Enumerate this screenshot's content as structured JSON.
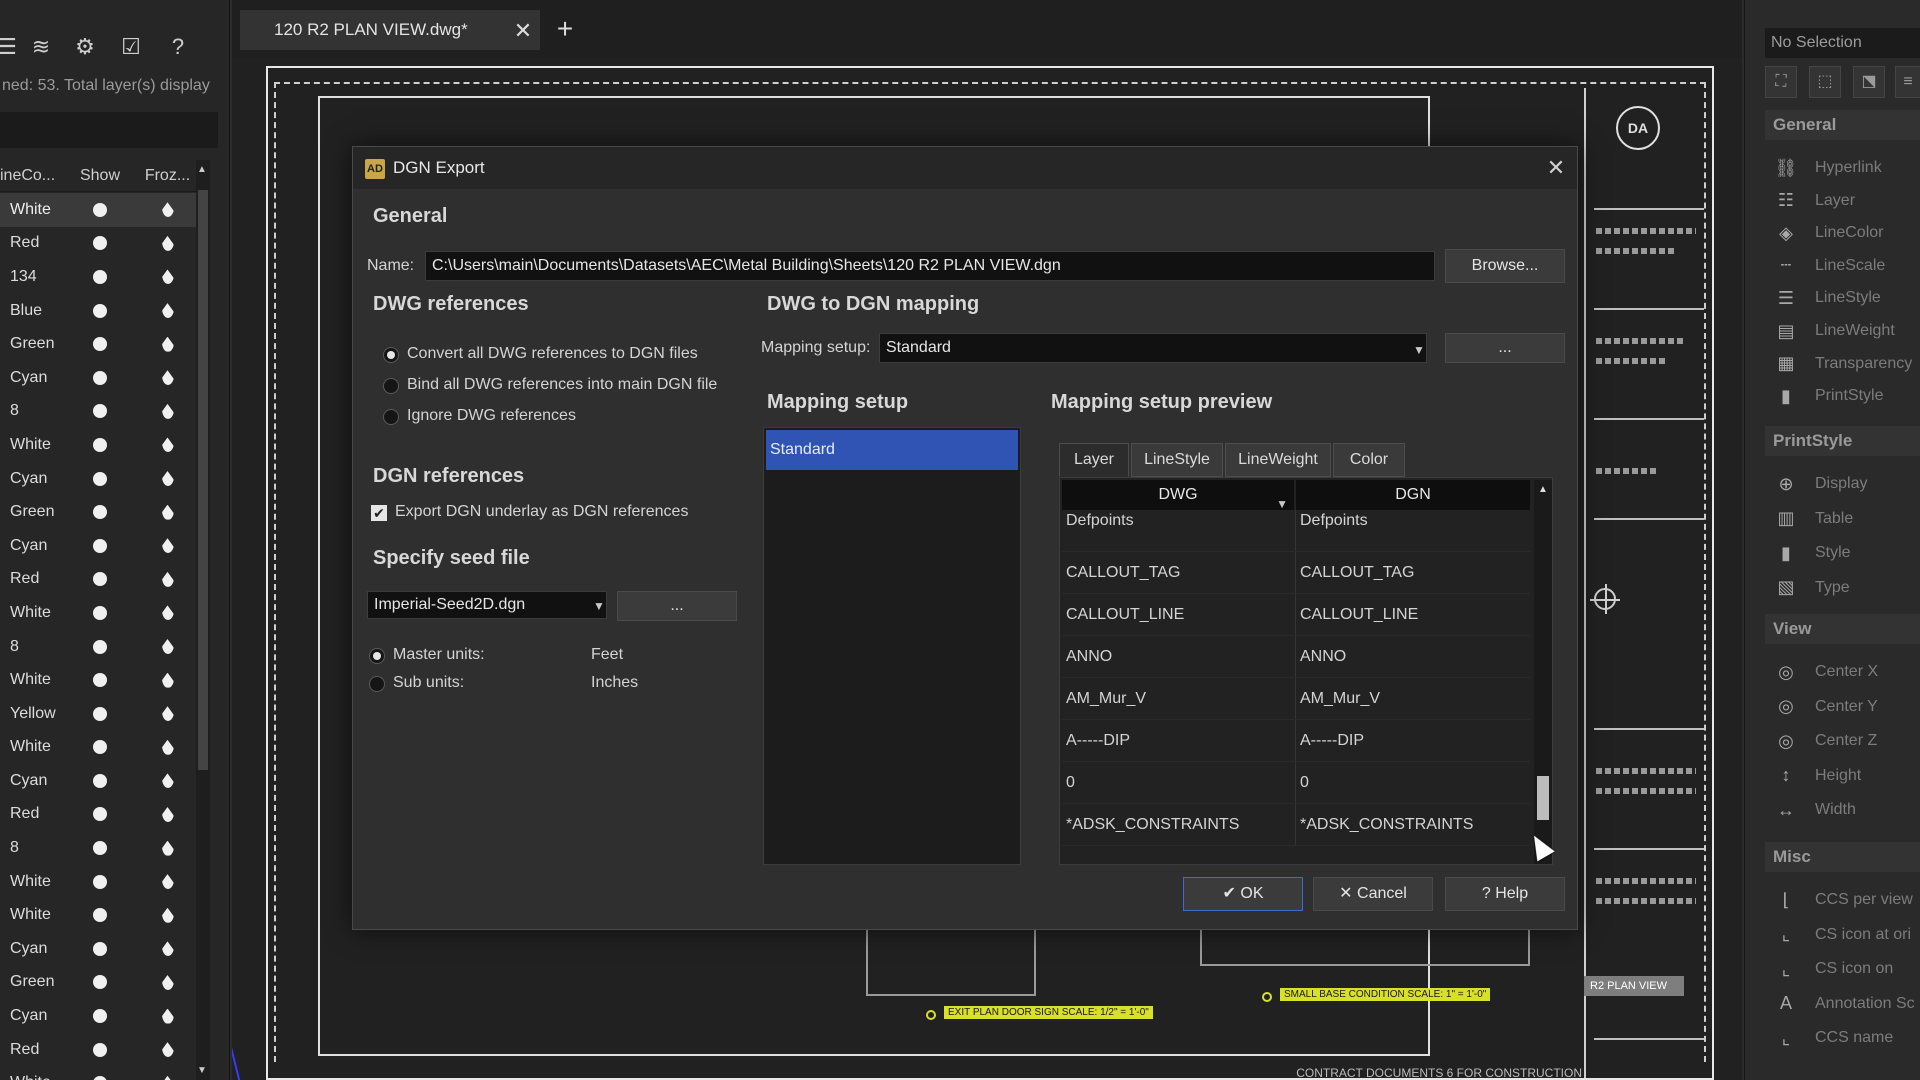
{
  "left_panel": {
    "toolbar_icons": [
      "layer-list-icon",
      "layer-filter-icon",
      "settings-gear-icon",
      "layer-check-icon",
      "help-icon"
    ],
    "summary": "ned: 53. Total layer(s) display",
    "columns": {
      "linecolor": "ineCo...",
      "show": "Show",
      "frozen": "Froz..."
    },
    "layers": [
      "White",
      "Red",
      "134",
      "Blue",
      "Green",
      "Cyan",
      "8",
      "White",
      "Cyan",
      "Green",
      "Cyan",
      "Red",
      "White",
      "8",
      "White",
      "Yellow",
      "White",
      "Cyan",
      "Red",
      "8",
      "White",
      "White",
      "Cyan",
      "Green",
      "Cyan",
      "Red",
      "White"
    ]
  },
  "tabbar": {
    "doc_tab": "120 R2 PLAN VIEW.dwg*",
    "close_glyph": "✕",
    "new_tab_glyph": "+"
  },
  "canvas": {
    "plan_label": "R2 PLAN VIEW",
    "footer": "CONTRACT DOCUMENTS 6 FOR CONSTRUCTION",
    "seal_text": "DA",
    "callout_a": "EXIT PLAN DOOR SIGN  SCALE: 1/2\" = 1'-0\"",
    "callout_b": "SMALL BASE CONDITION  SCALE: 1\" = 1'-0\""
  },
  "dialog": {
    "title": "DGN Export",
    "close_glyph": "✕",
    "general": {
      "heading": "General",
      "name_label": "Name:",
      "name_value": "C:\\Users\\main\\Documents\\Datasets\\AEC\\Metal Building\\Sheets\\120 R2 PLAN VIEW.dgn",
      "browse": "Browse..."
    },
    "dwg_references": {
      "heading": "DWG references",
      "options": [
        {
          "label": "Convert all DWG references to DGN files",
          "selected": true
        },
        {
          "label": "Bind all DWG references into main DGN file",
          "selected": false
        },
        {
          "label": "Ignore DWG references",
          "selected": false
        }
      ]
    },
    "dgn_references": {
      "heading": "DGN references",
      "checkbox": "Export DGN underlay as DGN references",
      "checked": true
    },
    "seed_file": {
      "heading": "Specify seed file",
      "value": "Imperial-Seed2D.dgn",
      "more": "...",
      "master_units_label": "Master units:",
      "master_units_value": "Feet",
      "sub_units_label": "Sub units:",
      "sub_units_value": "Inches",
      "master_selected": true
    },
    "mapping": {
      "heading": "DWG to DGN mapping",
      "setup_label": "Mapping setup:",
      "setup_value": "Standard",
      "more": "...",
      "list_heading": "Mapping setup",
      "list_items": [
        "Standard"
      ],
      "preview_heading": "Mapping setup preview",
      "tabs": [
        "Layer",
        "LineStyle",
        "LineWeight",
        "Color"
      ],
      "active_tab": "Layer",
      "columns": [
        "DWG",
        "DGN"
      ],
      "rows": [
        [
          "Defpoints",
          "Defpoints"
        ],
        [
          "CALLOUT_TAG",
          "CALLOUT_TAG"
        ],
        [
          "CALLOUT_LINE",
          "CALLOUT_LINE"
        ],
        [
          "ANNO",
          "ANNO"
        ],
        [
          "AM_Mur_V",
          "AM_Mur_V"
        ],
        [
          "A-----DIP",
          "A-----DIP"
        ],
        [
          "0",
          "0"
        ],
        [
          "*ADSK_CONSTRAINTS",
          "*ADSK_CONSTRAINTS"
        ]
      ]
    },
    "buttons": {
      "ok": "✔ OK",
      "cancel": "✕ Cancel",
      "help": "? Help"
    }
  },
  "right_panel": {
    "selection": "No Selection",
    "sections": {
      "general": {
        "title": "General",
        "items": [
          {
            "label": "Hyperlink",
            "icon": "hyperlink-icon"
          },
          {
            "label": "Layer",
            "icon": "layer-icon"
          },
          {
            "label": "LineColor",
            "icon": "line-color-icon"
          },
          {
            "label": "LineScale",
            "icon": "line-scale-icon"
          },
          {
            "label": "LineStyle",
            "icon": "line-style-icon"
          },
          {
            "label": "LineWeight",
            "icon": "line-weight-icon"
          },
          {
            "label": "Transparency",
            "icon": "transparency-icon"
          },
          {
            "label": "PrintStyle",
            "icon": "print-style-icon"
          }
        ]
      },
      "printstyle": {
        "title": "PrintStyle",
        "items": [
          {
            "label": "Display",
            "icon": "display-icon"
          },
          {
            "label": "Table",
            "icon": "table-icon"
          },
          {
            "label": "Style",
            "icon": "style-icon"
          },
          {
            "label": "Type",
            "icon": "type-icon"
          }
        ]
      },
      "view": {
        "title": "View",
        "items": [
          {
            "label": "Center X",
            "icon": "center-x-icon"
          },
          {
            "label": "Center Y",
            "icon": "center-y-icon"
          },
          {
            "label": "Center Z",
            "icon": "center-z-icon"
          },
          {
            "label": "Height",
            "icon": "height-icon"
          },
          {
            "label": "Width",
            "icon": "width-icon"
          }
        ]
      },
      "misc": {
        "title": "Misc",
        "items": [
          {
            "label": "CCS per view",
            "icon": "ccs-per-view-icon"
          },
          {
            "label": "CS icon at ori",
            "icon": "cs-icon-origin-icon"
          },
          {
            "label": "CS icon on",
            "icon": "cs-icon-on-icon"
          },
          {
            "label": "Annotation Sc",
            "icon": "annotation-scale-icon"
          },
          {
            "label": "CCS name",
            "icon": "ccs-name-icon"
          }
        ]
      }
    }
  }
}
